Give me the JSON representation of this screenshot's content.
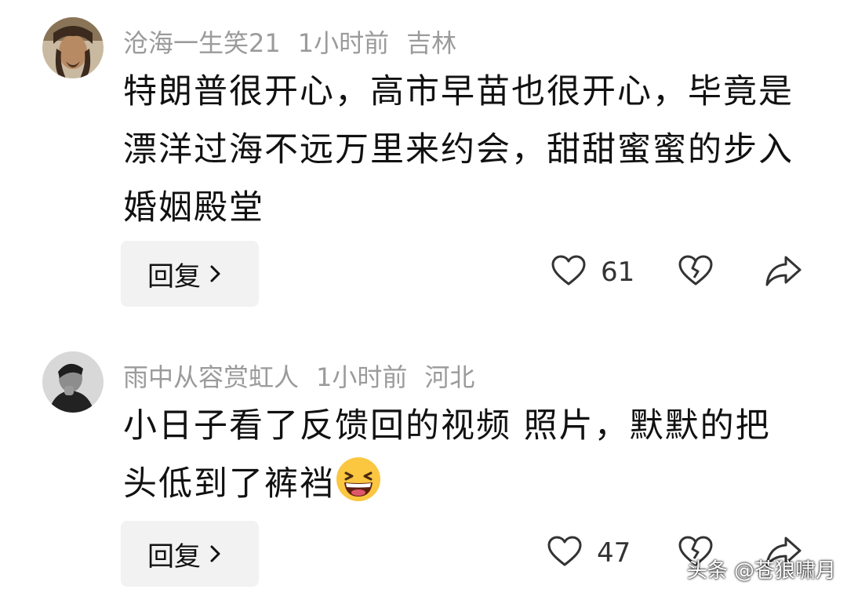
{
  "comments": [
    {
      "username": "沧海一生笑21",
      "time": "1小时前",
      "location": "吉林",
      "text": "特朗普很开心，高市早苗也很开心，毕竟是漂洋过海不远万里来约会，甜甜蜜蜜的步入婚姻殿堂",
      "reply_label": "回复",
      "likes": "61"
    },
    {
      "username": "雨中从容赏虹人",
      "time": "1小时前",
      "location": "河北",
      "text": "小日子看了反馈回的视频 照片，默默的把头低到了裤裆",
      "emoji": "grinning-face-emoji",
      "reply_label": "回复",
      "likes": "47"
    }
  ],
  "watermark": "头条 @苍狼啸月",
  "icons": [
    "heart-icon",
    "broken-heart-icon",
    "share-arrow-icon",
    "chevron-right-icon"
  ],
  "colors": {
    "meta": "#9b9b9b",
    "text": "#111111",
    "reply_bg": "#f2f2f2"
  }
}
